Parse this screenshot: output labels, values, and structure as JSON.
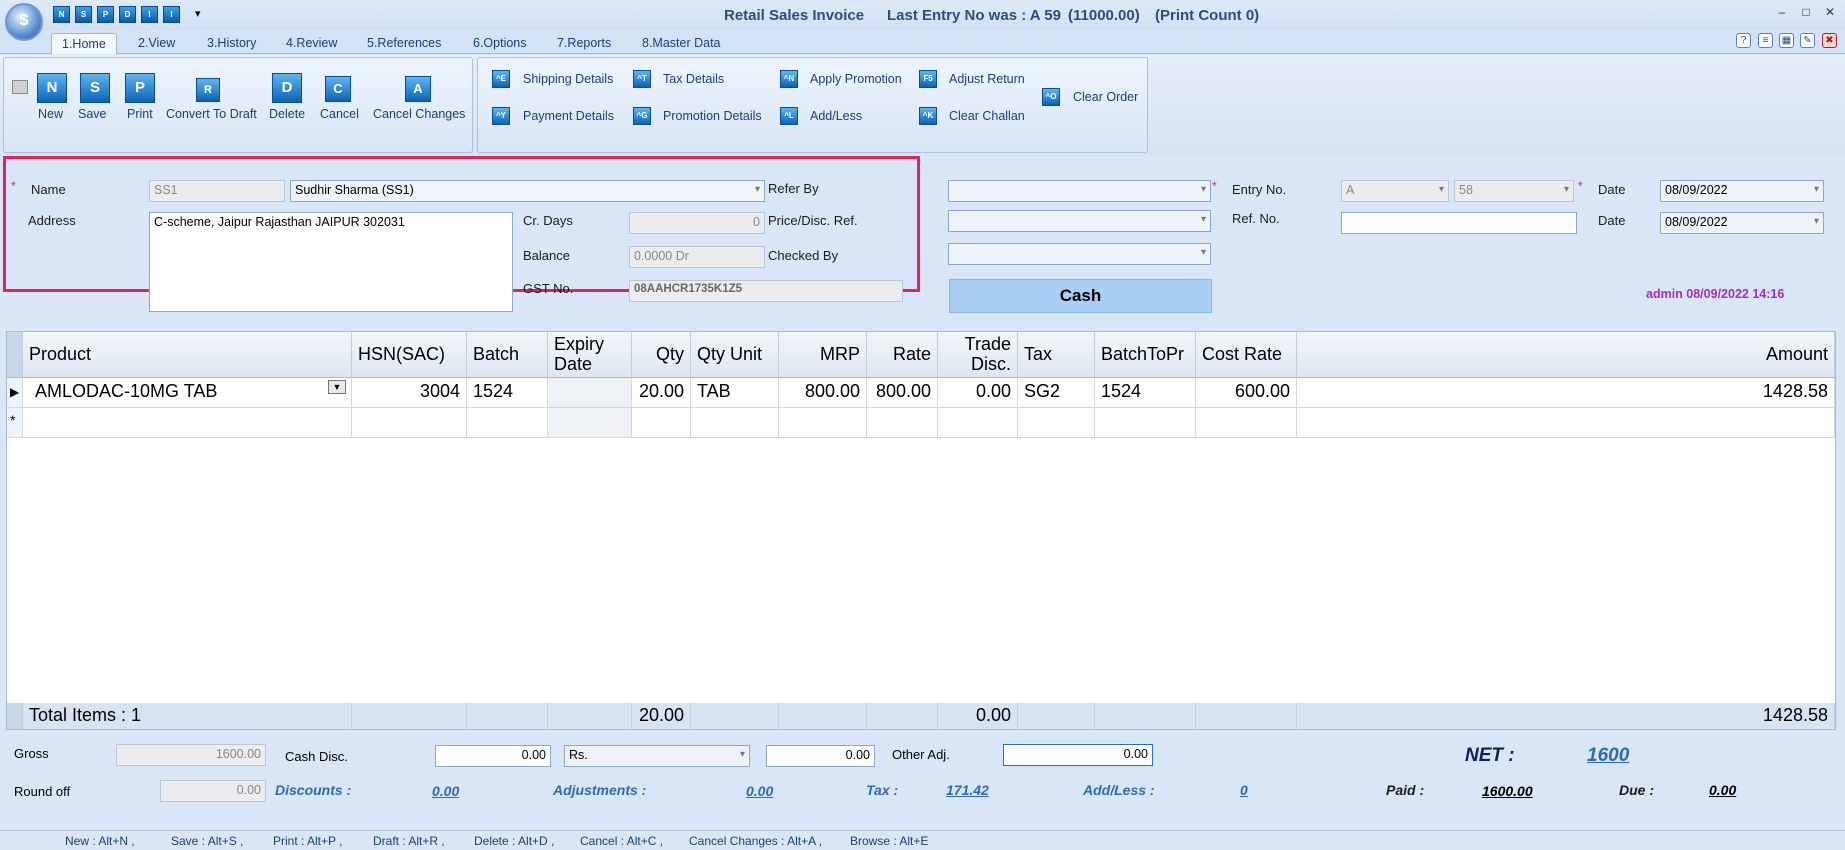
{
  "window": {
    "title": "Retail Sales Invoice",
    "last_entry": "Last Entry No was : A 59",
    "last_amount": "(11000.00)",
    "print_count": "(Print Count 0)"
  },
  "quick_access": [
    "N",
    "S",
    "P",
    "D",
    "I",
    "I"
  ],
  "tabs": [
    "1.Home",
    "2.View",
    "3.History",
    "4.Review",
    "5.References",
    "6.Options",
    "7.Reports",
    "8.Master Data"
  ],
  "ribbon": {
    "main_buttons": [
      {
        "label": "New",
        "icon": "N"
      },
      {
        "label": "Save",
        "icon": "S"
      },
      {
        "label": "Print",
        "icon": "P"
      },
      {
        "label": "Convert To Draft",
        "icon": "R"
      },
      {
        "label": "Delete",
        "icon": "D"
      },
      {
        "label": "Cancel",
        "icon": "C"
      },
      {
        "label": "Cancel Changes",
        "icon": "A"
      }
    ],
    "small_buttons": [
      {
        "label": "Shipping Details",
        "icon": "^E"
      },
      {
        "label": "Payment Details",
        "icon": "^Y"
      },
      {
        "label": "Tax Details",
        "icon": "^T"
      },
      {
        "label": "Promotion Details",
        "icon": "^G"
      },
      {
        "label": "Apply Promotion",
        "icon": "^N"
      },
      {
        "label": "Add/Less",
        "icon": "^L"
      },
      {
        "label": "Adjust Return",
        "icon": "F5"
      },
      {
        "label": "Clear Challan",
        "icon": "^K"
      },
      {
        "label": "Clear Order",
        "icon": "^O"
      }
    ]
  },
  "form": {
    "name_label": "Name",
    "name_code": "SS1",
    "name_value": "Sudhir Sharma  (SS1)",
    "address_label": "Address",
    "address_value": "C-scheme, Jaipur Rajasthan  JAIPUR           302031",
    "cr_days_label": "Cr. Days",
    "cr_days_value": "0",
    "balance_label": "Balance",
    "balance_value": "0.0000 Dr",
    "gst_label": "GST No.",
    "gst_value": "08AAHCR1735K1Z5",
    "refer_by_label": "Refer By",
    "price_ref_label": "Price/Disc. Ref.",
    "checked_by_label": "Checked By",
    "cash_button": "Cash",
    "entry_no_label": "Entry No.",
    "entry_series": "A",
    "entry_number": "58",
    "ref_no_label": "Ref. No.",
    "date_label": "Date",
    "date_value": "08/09/2022",
    "date2_label": "Date",
    "date2_value": "08/09/2022",
    "admin_stamp": "admin 08/09/2022 14:16"
  },
  "grid": {
    "columns": [
      "Product",
      "HSN(SAC)",
      "Batch",
      "Expiry Date",
      "Qty",
      "Qty Unit",
      "MRP",
      "Rate",
      "Trade Disc.",
      "Tax",
      "BatchToPr",
      "Cost Rate",
      "Amount"
    ],
    "rows": [
      [
        "AMLODAC-10MG TAB",
        "3004",
        "1524",
        "",
        "20.00",
        "TAB",
        "800.00",
        "800.00",
        "0.00",
        "SG2",
        "1524",
        "600.00",
        "1428.58"
      ]
    ],
    "footer": {
      "total_items": "Total Items : 1",
      "qty": "20.00",
      "trade_disc": "0.00",
      "amount": "1428.58"
    }
  },
  "bottom": {
    "gross_label": "Gross",
    "gross_value": "1600.00",
    "cash_disc_label": "Cash Disc.",
    "cash_disc_value": "0.00",
    "cash_disc_mode": "Rs.",
    "cash_disc_amount": "0.00",
    "other_adj_label": "Other Adj.",
    "other_adj_value": "0.00",
    "net_label": "NET :",
    "net_value": "1600",
    "round_off_label": "Round off",
    "round_off_value": "0.00",
    "discounts_label": "Discounts :",
    "discounts_value": "0.00",
    "adjustments_label": "Adjustments :",
    "adjustments_value": "0.00",
    "tax_label": "Tax :",
    "tax_value": "171.42",
    "addless_label": "Add/Less :",
    "addless_value": "0",
    "paid_label": "Paid :",
    "paid_value": "1600.00",
    "due_label": "Due :",
    "due_value": "0.00"
  },
  "shortcuts": [
    "New : Alt+N ,",
    "Save : Alt+S ,",
    "Print : Alt+P ,",
    "Draft : Alt+R ,",
    "Delete : Alt+D ,",
    "Cancel : Alt+C ,",
    "Cancel Changes : Alt+A ,",
    "Browse : Alt+E"
  ],
  "colors": {
    "highlight_border": "#e0245e",
    "cash_button": "#a9cff5",
    "admin_text": "#9b30c8",
    "net_text": "#0d1f5c"
  }
}
